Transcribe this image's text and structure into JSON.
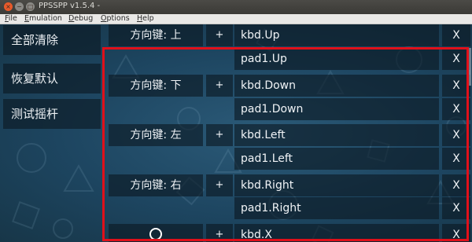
{
  "window": {
    "title": "PPSSPP v1.5.4 -",
    "close_glyph": "×",
    "min_glyph": "−",
    "max_glyph": "□"
  },
  "menubar": {
    "items": [
      {
        "mnemonic": "F",
        "rest": "ile"
      },
      {
        "mnemonic": "E",
        "rest": "mulation"
      },
      {
        "mnemonic": "D",
        "rest": "ebug"
      },
      {
        "mnemonic": "O",
        "rest": "ptions"
      },
      {
        "mnemonic": "H",
        "rest": "elp"
      }
    ]
  },
  "sidebar": {
    "clear_all": "全部清除",
    "restore_defaults": "恢复默认",
    "test_analog": "测试摇杆"
  },
  "mappings": [
    {
      "key": "方向键: 上",
      "plus": "+",
      "bindings": [
        "kbd.Up",
        "pad1.Up"
      ]
    },
    {
      "key": "方向键: 下",
      "plus": "+",
      "bindings": [
        "kbd.Down",
        "pad1.Down"
      ]
    },
    {
      "key": "方向键: 左",
      "plus": "+",
      "bindings": [
        "kbd.Left",
        "pad1.Left"
      ]
    },
    {
      "key": "方向键: 右",
      "plus": "+",
      "bindings": [
        "kbd.Right",
        "pad1.Right"
      ]
    },
    {
      "key_icon": "circle-icon",
      "plus": "+",
      "bindings": [
        "kbd.X"
      ]
    }
  ],
  "remove_label": "X",
  "colors": {
    "highlight": "#e0101a",
    "close_button": "#e95a2a",
    "background": "#1d4560"
  }
}
